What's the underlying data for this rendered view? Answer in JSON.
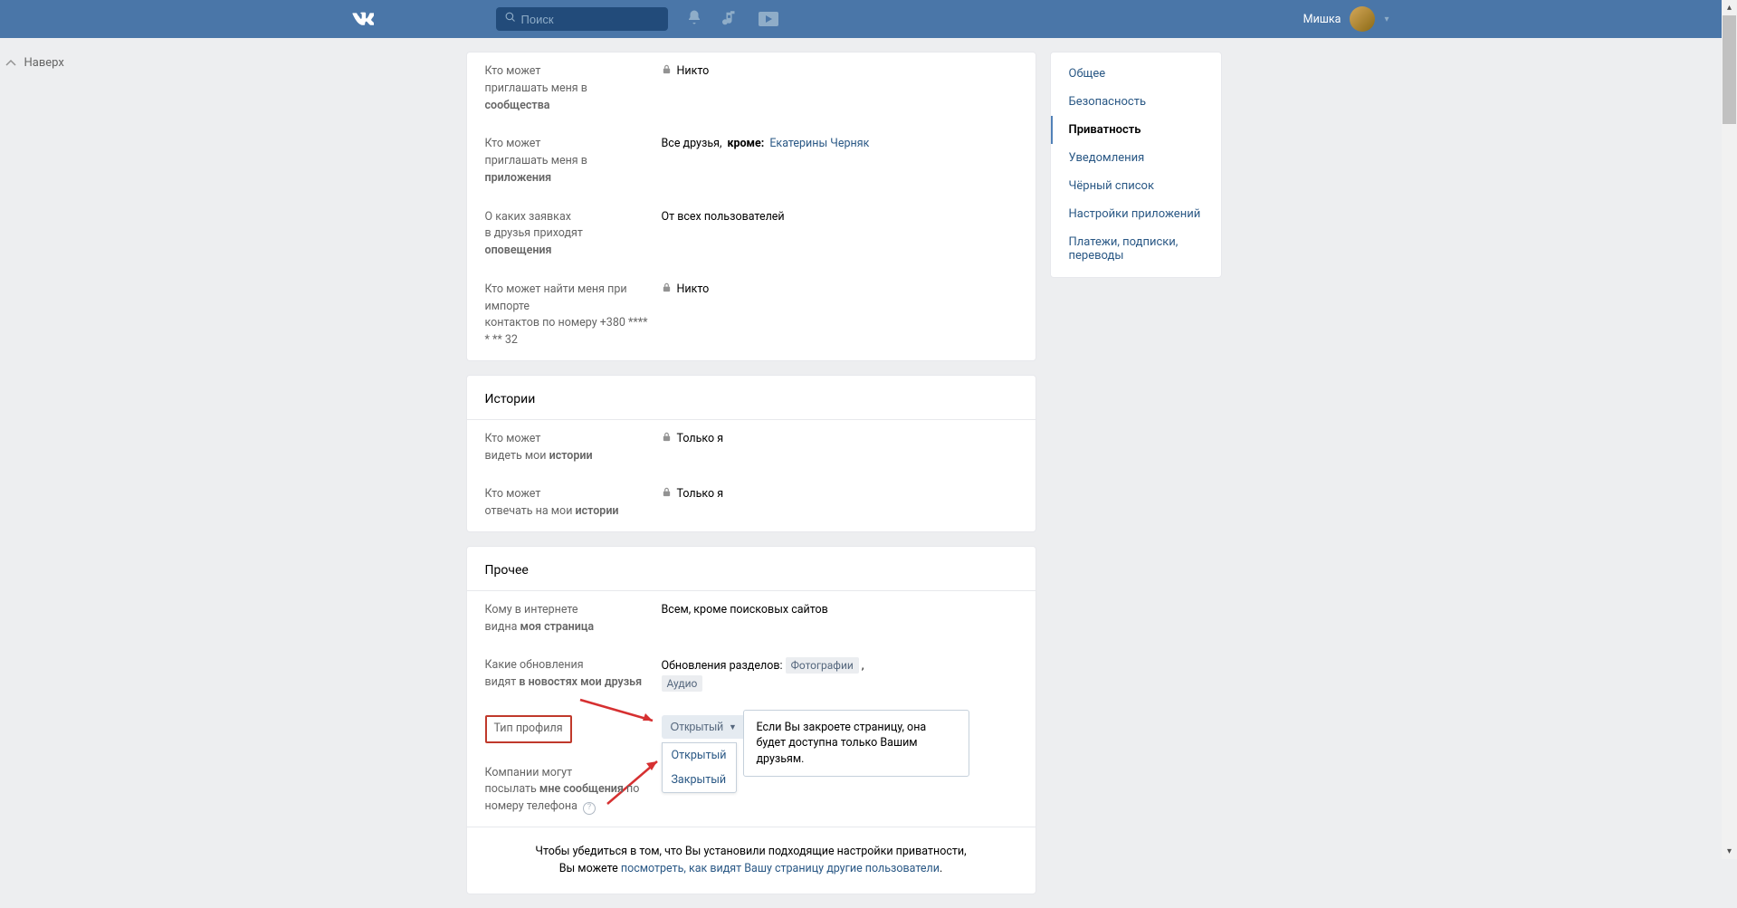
{
  "header": {
    "search_placeholder": "Поиск",
    "username": "Мишка"
  },
  "back_top": "Наверх",
  "settings": {
    "contact_rows": [
      {
        "line1": "Кто может",
        "line2_prefix": "приглашать меня в ",
        "line2_bold": "сообщества",
        "value": "Никто",
        "locked": true
      },
      {
        "line1": "Кто может",
        "line2_prefix": "приглашать меня в ",
        "line2_bold": "приложения",
        "value_prefix": "Все друзья, ",
        "value_bold": "кроме:",
        "value_link": "Екатерины Черняк",
        "locked": false
      },
      {
        "line1": "О каких заявках",
        "line2_prefix": "в друзья приходят ",
        "line2_bold": "оповещения",
        "value": "От всех пользователей",
        "locked": false
      },
      {
        "line1": "Кто может найти меня при импорте",
        "line2": "контактов по номеру +380 **** * ** 32",
        "value": "Никто",
        "locked": true
      }
    ],
    "stories_title": "Истории",
    "stories_rows": [
      {
        "line1": "Кто может",
        "line2_prefix": "видеть мои ",
        "line2_bold": "истории",
        "value": "Только я",
        "locked": true
      },
      {
        "line1": "Кто может",
        "line2_prefix": "отвечать на мои ",
        "line2_bold": "истории",
        "value": "Только я",
        "locked": true
      }
    ],
    "other_title": "Прочее",
    "other_rows": {
      "internet": {
        "line1": "Кому в интернете",
        "line2_prefix": "видна ",
        "line2_bold": "моя страница",
        "value": "Всем, кроме поисковых сайтов"
      },
      "updates": {
        "line1": "Какие обновления",
        "line2_prefix": "видят ",
        "line2_bold": "в новостях мои друзья",
        "value_prefix": "Обновления разделов: ",
        "tag1": "Фотографии",
        "tag2": "Аудио"
      },
      "profile_type": {
        "label": "Тип профиля",
        "selected": "Открытый",
        "options": [
          "Открытый",
          "Закрытый"
        ],
        "tooltip": "Если Вы закроете страницу, она будет доступна только Вашим друзьям."
      },
      "companies": {
        "line1": "Компании могут",
        "line2_prefix": "посылать ",
        "line2_bold": "мне сообщения",
        "line2_suffix": " по номеру телефона"
      }
    },
    "footer": {
      "line1": "Чтобы убедиться в том, что Вы установили подходящие настройки приватности,",
      "line2_prefix": "Вы можете ",
      "line2_link": "посмотреть, как видят Вашу страницу другие пользователи",
      "line2_suffix": "."
    }
  },
  "sidebar": {
    "items": [
      "Общее",
      "Безопасность",
      "Приватность",
      "Уведомления",
      "Чёрный список",
      "Настройки приложений",
      "Платежи, подписки, переводы"
    ],
    "active_index": 2
  }
}
